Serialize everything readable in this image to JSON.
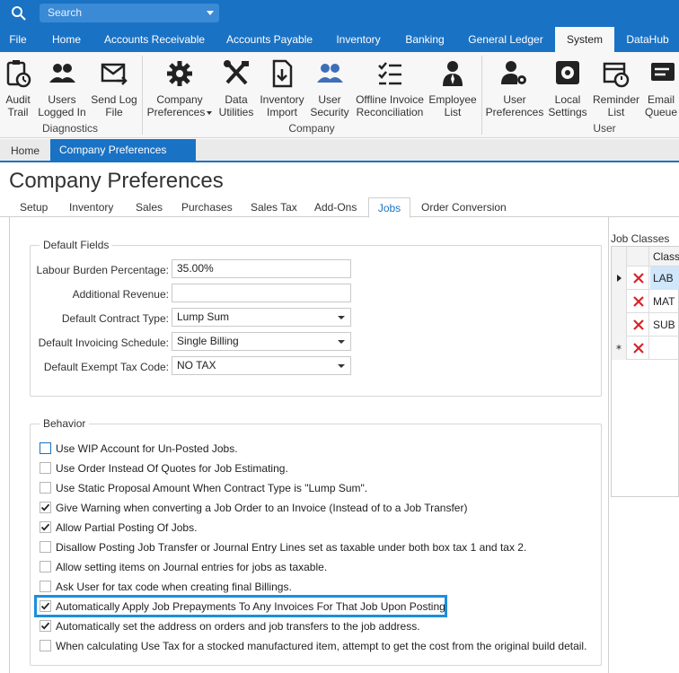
{
  "search": {
    "placeholder": "Search"
  },
  "menu": [
    "File",
    "Home",
    "Accounts Receivable",
    "Accounts Payable",
    "Inventory",
    "Banking",
    "General Ledger",
    "System",
    "DataHub"
  ],
  "ribbon": {
    "buttons": [
      {
        "l1": "Audit",
        "l2": "Trail"
      },
      {
        "l1": "Users",
        "l2": "Logged In"
      },
      {
        "l1": "Send Log",
        "l2": "File"
      },
      {
        "l1": "Company",
        "l2": "Preferences"
      },
      {
        "l1": "Data",
        "l2": "Utilities"
      },
      {
        "l1": "Inventory",
        "l2": "Import"
      },
      {
        "l1": "User",
        "l2": "Security"
      },
      {
        "l1": "Offline Invoice",
        "l2": "Reconciliation"
      },
      {
        "l1": "Employee",
        "l2": "List"
      },
      {
        "l1": "User",
        "l2": "Preferences"
      },
      {
        "l1": "Local",
        "l2": "Settings"
      },
      {
        "l1": "Reminder",
        "l2": "List"
      },
      {
        "l1": "Email",
        "l2": "Queue"
      }
    ],
    "groups": [
      "Diagnostics",
      "Company",
      "User"
    ]
  },
  "doc_tabs": {
    "home": "Home",
    "current": "Company Preferences"
  },
  "page": {
    "title": "Company Preferences"
  },
  "sub_tabs": [
    "Setup",
    "Inventory",
    "Sales",
    "Purchases",
    "Sales Tax",
    "Add-Ons",
    "Jobs",
    "Order Conversion"
  ],
  "default_fields": {
    "title": "Default Fields",
    "labour_label": "Labour Burden Percentage:",
    "labour_value": "35.00%",
    "revenue_label": "Additional Revenue:",
    "revenue_value": "",
    "contract_label": "Default Contract Type:",
    "contract_value": "Lump Sum",
    "invoicing_label": "Default Invoicing Schedule:",
    "invoicing_value": "Single Billing",
    "tax_label": "Default Exempt Tax Code:",
    "tax_value": "NO TAX"
  },
  "behavior": {
    "title": "Behavior",
    "items": [
      {
        "text": "Use WIP Account for Un-Posted Jobs.",
        "checked": false
      },
      {
        "text": "Use Order Instead Of Quotes for Job Estimating.",
        "checked": false
      },
      {
        "text": "Use Static Proposal Amount When Contract Type is \"Lump Sum\".",
        "checked": false
      },
      {
        "text": "Give Warning when converting a Job Order to an Invoice (Instead of to a Job Transfer)",
        "checked": true
      },
      {
        "text": "Allow Partial Posting Of Jobs.",
        "checked": true
      },
      {
        "text": "Disallow Posting Job Transfer or Journal Entry Lines set as taxable under both box tax 1 and tax 2.",
        "checked": false
      },
      {
        "text": "Allow setting items on Journal entries for jobs as taxable.",
        "checked": false
      },
      {
        "text": "Ask User for tax code when creating final Billings.",
        "checked": false
      },
      {
        "text": "Automatically Apply Job Prepayments To Any Invoices For That Job Upon Posting.",
        "checked": true
      },
      {
        "text": "Automatically set the address on orders and job transfers to the job address.",
        "checked": true
      },
      {
        "text": "When calculating Use Tax for a stocked manufactured item, attempt to get the cost from the original build detail.",
        "checked": false
      }
    ]
  },
  "job_classes": {
    "title": "Job Classes",
    "header": "Classi",
    "rows": [
      "LAB",
      "MAT",
      "SUB"
    ]
  }
}
